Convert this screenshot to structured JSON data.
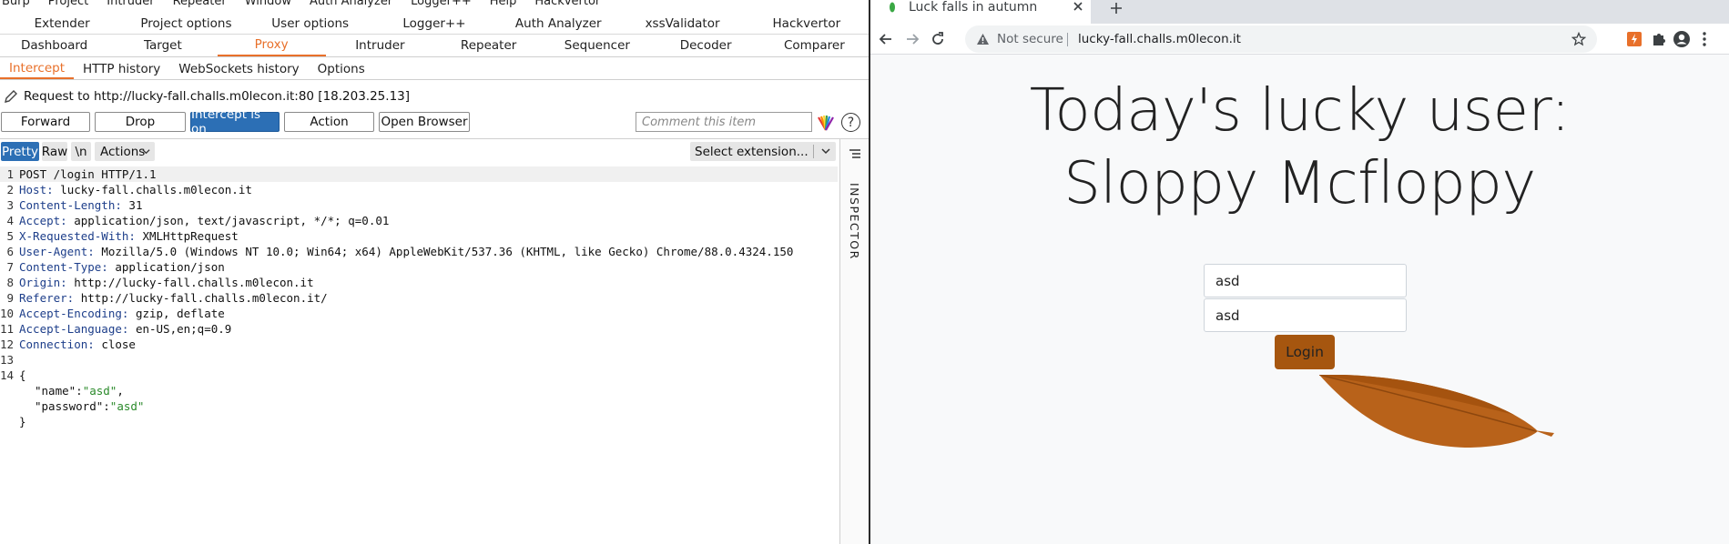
{
  "burp": {
    "menu": [
      "Burp",
      "Project",
      "Intruder",
      "Repeater",
      "Window",
      "Auth Analyzer",
      "Logger++",
      "Help",
      "Hackvertor"
    ],
    "tabs_row1": [
      "Extender",
      "Project options",
      "User options",
      "Logger++",
      "Auth Analyzer",
      "xssValidator",
      "Hackvertor"
    ],
    "tabs_row2": [
      "Dashboard",
      "Target",
      "Proxy",
      "Intruder",
      "Repeater",
      "Sequencer",
      "Decoder",
      "Comparer"
    ],
    "tabs_row2_active": "Proxy",
    "proxy_tabs": [
      "Intercept",
      "HTTP history",
      "WebSockets history",
      "Options"
    ],
    "proxy_tabs_active": "Intercept",
    "request_to": "Request to http://lucky-fall.challs.m0lecon.it:80  [18.203.25.13]",
    "buttons": {
      "forward": "Forward",
      "drop": "Drop",
      "intercept": "Intercept is on",
      "action": "Action",
      "open_browser": "Open Browser"
    },
    "comment_placeholder": "Comment this item",
    "help": "?",
    "editor_tools": {
      "pretty": "Pretty",
      "raw": "Raw",
      "newline": "\\n",
      "actions": "Actions",
      "select_extension": "Select extension..."
    },
    "inspector_label": "INSPECTOR",
    "request_lines": [
      {
        "n": "1",
        "key": "",
        "rest": "POST /login HTTP/1.1"
      },
      {
        "n": "2",
        "key": "Host:",
        "rest": " lucky-fall.challs.m0lecon.it"
      },
      {
        "n": "3",
        "key": "Content-Length:",
        "rest": " 31"
      },
      {
        "n": "4",
        "key": "Accept:",
        "rest": " application/json, text/javascript, */*; q=0.01"
      },
      {
        "n": "5",
        "key": "X-Requested-With:",
        "rest": " XMLHttpRequest"
      },
      {
        "n": "6",
        "key": "User-Agent:",
        "rest": " Mozilla/5.0 (Windows NT 10.0; Win64; x64) AppleWebKit/537.36 (KHTML, like Gecko) Chrome/88.0.4324.150"
      },
      {
        "n": "7",
        "key": "Content-Type:",
        "rest": " application/json"
      },
      {
        "n": "8",
        "key": "Origin:",
        "rest": " http://lucky-fall.challs.m0lecon.it"
      },
      {
        "n": "9",
        "key": "Referer:",
        "rest": " http://lucky-fall.challs.m0lecon.it/"
      },
      {
        "n": "10",
        "key": "Accept-Encoding:",
        "rest": " gzip, deflate"
      },
      {
        "n": "11",
        "key": "Accept-Language:",
        "rest": " en-US,en;q=0.9"
      },
      {
        "n": "12",
        "key": "Connection:",
        "rest": " close"
      },
      {
        "n": "13",
        "key": "",
        "rest": ""
      },
      {
        "n": "14",
        "key": "",
        "rest": "{"
      }
    ],
    "json_body": {
      "name_key": "\"name\"",
      "name_val": "\"asd\"",
      "password_key": "\"password\"",
      "password_val": "\"asd\"",
      "close": "}"
    }
  },
  "browser": {
    "tab_title": "Luck falls in autumn",
    "not_secure": "Not secure",
    "url": "lucky-fall.challs.m0lecon.it",
    "heading_line1": "Today's lucky user:",
    "heading_line2": "Sloppy Mcfloppy",
    "username_value": "asd",
    "password_value": "asd",
    "login_label": "Login"
  },
  "colors": {
    "burp_accent": "#e8702a",
    "burp_blue": "#2c6fb5",
    "login_button": "#a6560f",
    "leaf": "#b8621a"
  },
  "icons": [
    "pencil-icon",
    "color-highlight-icon",
    "help-icon",
    "chevron-down-icon",
    "inspector-menu-icon",
    "favicon-leaf-icon",
    "close-icon",
    "new-tab-icon",
    "back-icon",
    "forward-icon",
    "reload-icon",
    "warning-icon",
    "star-icon",
    "extension-icon",
    "puzzle-icon",
    "account-icon",
    "menu-icon",
    "leaf-illustration"
  ]
}
